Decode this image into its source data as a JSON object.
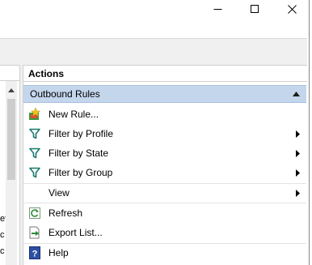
{
  "window": {
    "controls": [
      "minimize",
      "maximize",
      "close"
    ]
  },
  "left_pane": {
    "text_fragments": [
      "et",
      "c",
      "c"
    ]
  },
  "actions": {
    "header": "Actions",
    "section": {
      "title": "Outbound Rules",
      "items": [
        {
          "label": "New Rule...",
          "icon": "new-rule-icon",
          "submenu": false
        },
        {
          "label": "Filter by Profile",
          "icon": "filter-icon",
          "submenu": true
        },
        {
          "label": "Filter by State",
          "icon": "filter-icon",
          "submenu": true
        },
        {
          "label": "Filter by Group",
          "icon": "filter-icon",
          "submenu": true
        },
        {
          "label": "View",
          "icon": "none",
          "submenu": true
        },
        {
          "label": "Refresh",
          "icon": "refresh-icon",
          "submenu": false
        },
        {
          "label": "Export List...",
          "icon": "export-icon",
          "submenu": false
        },
        {
          "label": "Help",
          "icon": "help-icon",
          "submenu": false
        }
      ]
    }
  },
  "colors": {
    "section_header_bg": "#c4d6ec",
    "filter_icon": "#1a7a6e",
    "refresh_icon": "#2e8b3a",
    "help_icon": "#2d4fa3"
  }
}
